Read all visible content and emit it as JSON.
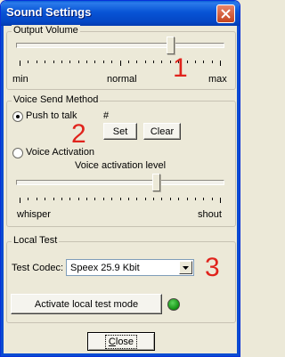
{
  "window": {
    "title": "Sound Settings"
  },
  "output_volume": {
    "label": "Output Volume",
    "level": 0.75,
    "scale": {
      "min": "min",
      "mid": "normal",
      "max": "max"
    },
    "annotation": "1"
  },
  "voice_send": {
    "label": "Voice Send Method",
    "push_to_talk": {
      "label": "Push to talk",
      "selected": true,
      "hotkey": "#"
    },
    "set_button": "Set",
    "clear_button": "Clear",
    "voice_activation": {
      "label": "Voice Activation",
      "selected": false
    },
    "level_label": "Voice activation level",
    "level": 0.68,
    "scale": {
      "min": "whisper",
      "max": "shout"
    },
    "annotation": "2"
  },
  "local_test": {
    "label": "Local Test",
    "codec_label": "Test Codec:",
    "codec_value": "Speex 25.9 Kbit",
    "activate_button": "Activate local test mode",
    "led_color": "#1a9a1a",
    "annotation": "3"
  },
  "close_button": {
    "label_first": "C",
    "label_rest": "lose"
  },
  "colors": {
    "title_bar": "#0854d6",
    "annotation_red": "#e0231c",
    "face": "#ece9d8"
  }
}
